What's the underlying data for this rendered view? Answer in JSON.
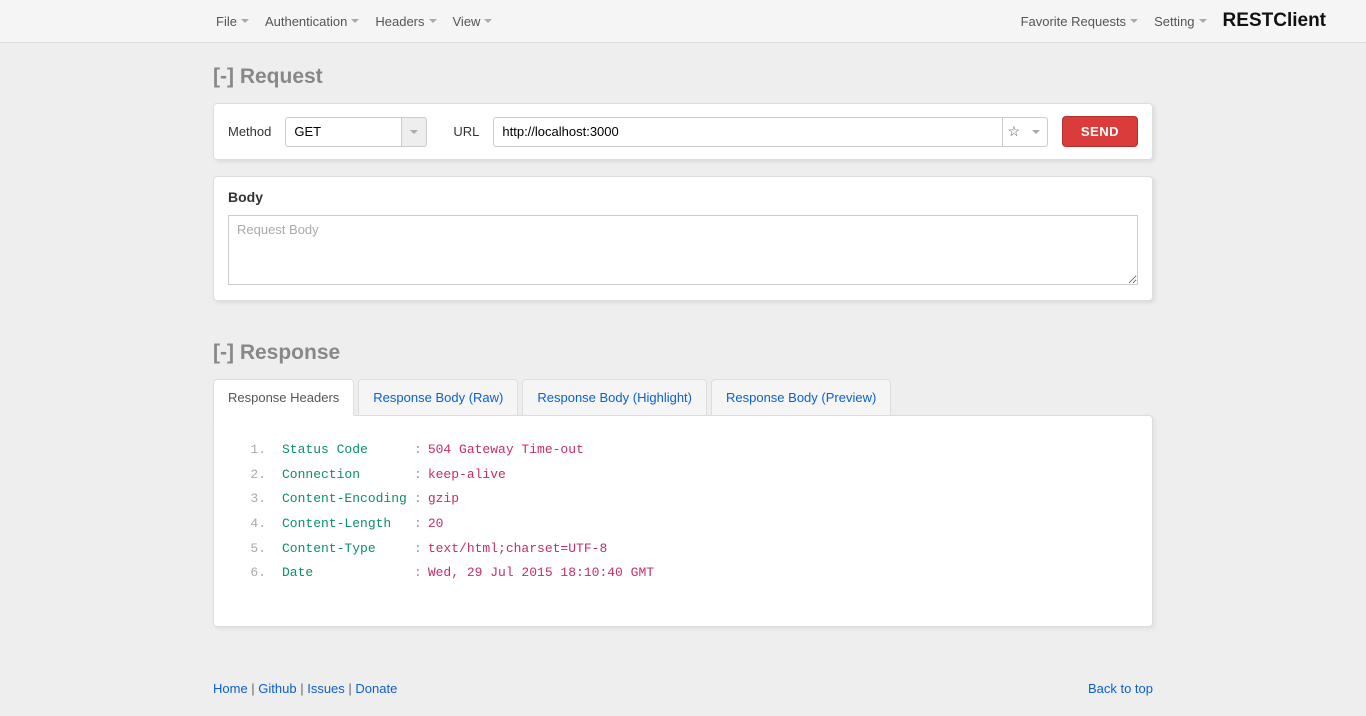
{
  "brand": "RESTClient",
  "menu": {
    "left": [
      "File",
      "Authentication",
      "Headers",
      "View"
    ],
    "right": [
      "Favorite Requests",
      "Setting"
    ]
  },
  "request": {
    "section_title": "Request",
    "toggle": "[-]",
    "method_label": "Method",
    "method_value": "GET",
    "url_label": "URL",
    "url_value": "http://localhost:3000",
    "send_label": "SEND",
    "body_title": "Body",
    "body_placeholder": "Request Body"
  },
  "response": {
    "section_title": "Response",
    "toggle": "[-]",
    "tabs": [
      "Response Headers",
      "Response Body (Raw)",
      "Response Body (Highlight)",
      "Response Body (Preview)"
    ],
    "active_tab": 0,
    "headers": [
      {
        "key": "Status Code",
        "value": "504 Gateway Time-out"
      },
      {
        "key": "Connection",
        "value": "keep-alive"
      },
      {
        "key": "Content-Encoding",
        "value": "gzip"
      },
      {
        "key": "Content-Length",
        "value": "20"
      },
      {
        "key": "Content-Type",
        "value": "text/html;charset=UTF-8"
      },
      {
        "key": "Date",
        "value": "Wed, 29 Jul 2015 18:10:40 GMT"
      }
    ]
  },
  "footer": {
    "links": [
      "Home",
      "Github",
      "Issues",
      "Donate"
    ],
    "back_to_top": "Back to top"
  }
}
